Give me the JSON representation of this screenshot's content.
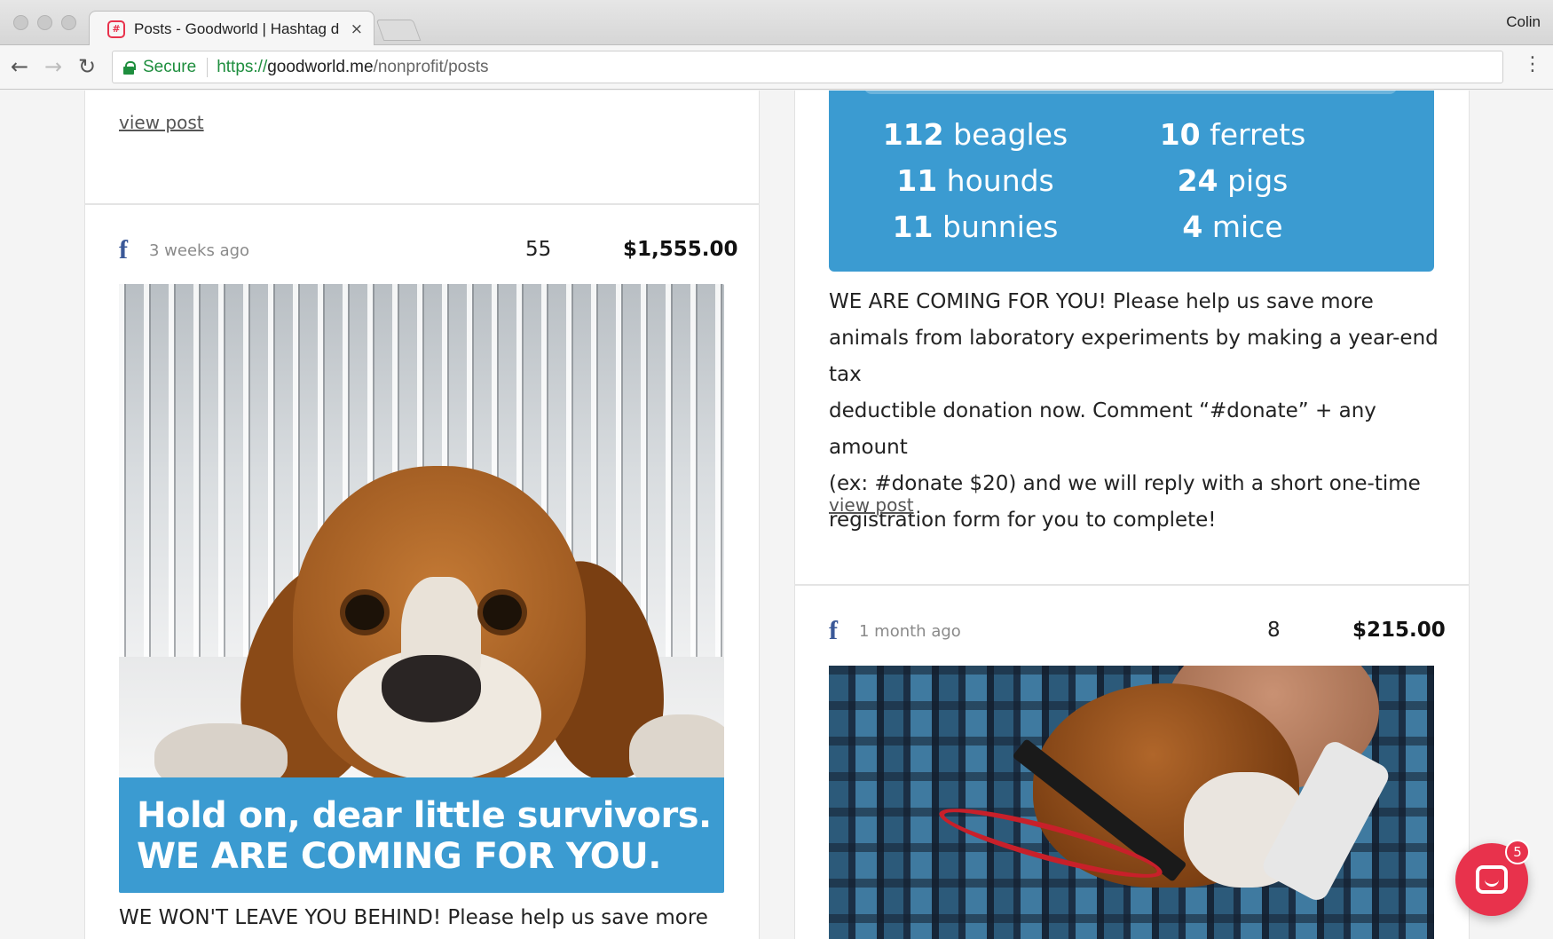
{
  "browser": {
    "tab_title": "Posts - Goodworld | Hashtag d",
    "tab_close": "×",
    "favicon": "#",
    "profile_name": "Colin",
    "secure_label": "Secure",
    "url_scheme": "https://",
    "url_host": "goodworld.me",
    "url_path": "/nonprofit/posts",
    "back_icon": "←",
    "forward_icon": "→",
    "reload_icon": "↻",
    "menu_icon": "⋮"
  },
  "colors": {
    "accent_blue": "#3b9bd1",
    "brand_red": "#e8324c",
    "facebook": "#3b5998",
    "secure_green": "#1e8e3e"
  },
  "posts": {
    "top_left": {
      "view_post": "view post"
    },
    "left_post": {
      "platform_icon": "facebook-icon",
      "fb_glyph": "f",
      "time": "3 weeks ago",
      "count": "55",
      "amount": "$1,555.00",
      "banner_line1": "Hold on, dear little survivors.",
      "banner_line2": "WE ARE COMING FOR YOU.",
      "body_line1": "WE WON'T LEAVE YOU BEHIND! Please help us save more"
    },
    "right_post": {
      "stats": [
        {
          "num": "112",
          "label": "beagles"
        },
        {
          "num": "10",
          "label": "ferrets"
        },
        {
          "num": "11",
          "label": "hounds"
        },
        {
          "num": "24",
          "label": "pigs"
        },
        {
          "num": "11",
          "label": "bunnies"
        },
        {
          "num": "4",
          "label": "mice"
        }
      ],
      "body_lines": [
        "WE ARE COMING FOR YOU! Please help us save more",
        "animals from laboratory experiments by making a year-end tax",
        "deductible donation now. Comment “#donate” + any amount",
        "(ex: #donate $20) and we will reply with a short one-time",
        "registration form for you to complete!"
      ],
      "view_post": "view post"
    },
    "bottom_right_post": {
      "platform_icon": "facebook-icon",
      "fb_glyph": "f",
      "time": "1 month ago",
      "count": "8",
      "amount": "$215.00"
    }
  },
  "chat": {
    "badge_count": "5"
  }
}
